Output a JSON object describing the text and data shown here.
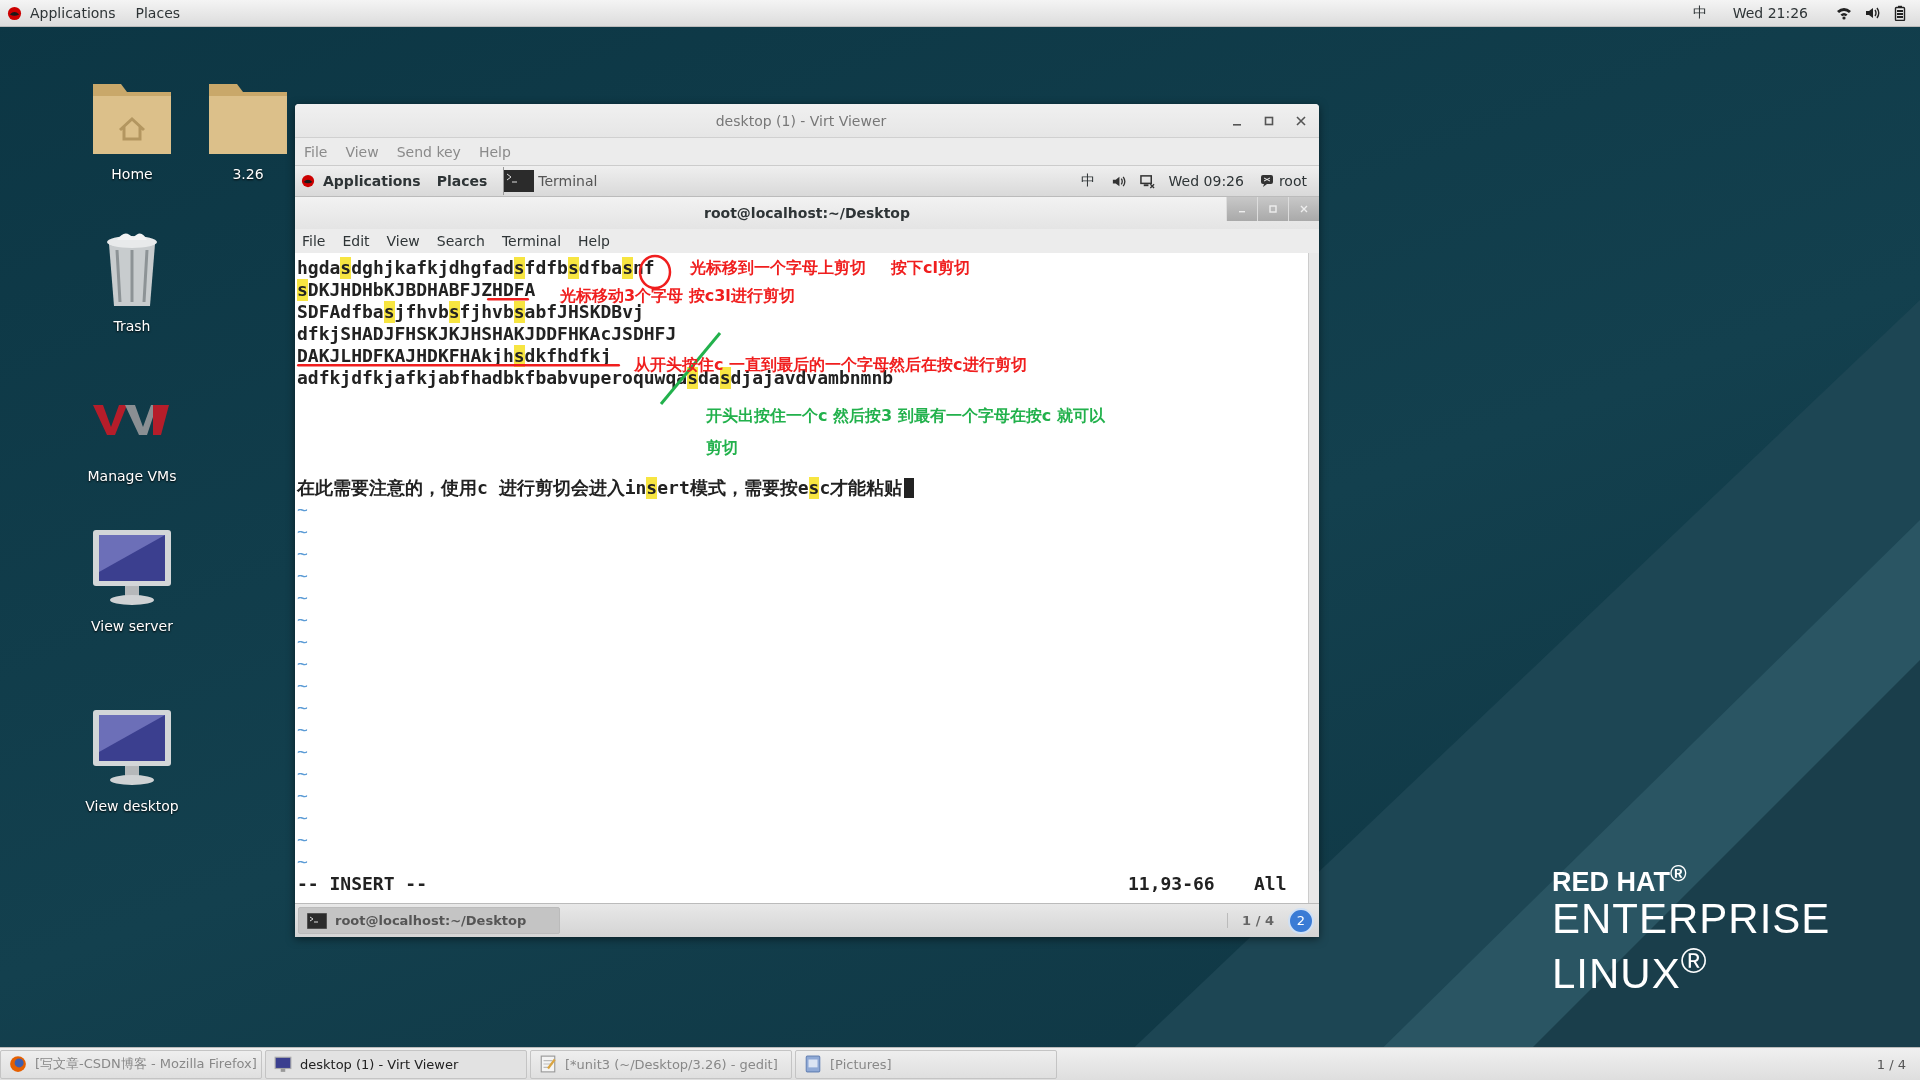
{
  "top_bar": {
    "menus": [
      "Applications",
      "Places"
    ],
    "input_method": "中",
    "clock": "Wed 21:26"
  },
  "desktop_icons": [
    {
      "label": "Home",
      "kind": "home"
    },
    {
      "label": "3.26",
      "kind": "folder"
    },
    {
      "label": "Trash",
      "kind": "trash"
    },
    {
      "label": "Manage VMs",
      "kind": "vm"
    },
    {
      "label": "View server",
      "kind": "monitor"
    },
    {
      "label": "View desktop",
      "kind": "monitor"
    }
  ],
  "viewer": {
    "title": "desktop (1) - Virt Viewer",
    "menus": [
      "File",
      "View",
      "Send key",
      "Help"
    ],
    "guest_panel": {
      "menus": [
        "Applications",
        "Places"
      ],
      "window_button": "Terminal",
      "input_method": "中",
      "clock": "Wed 09:26",
      "user": "root"
    },
    "terminal": {
      "title": "root@localhost:~/Desktop",
      "menus": [
        "File",
        "Edit",
        "View",
        "Search",
        "Terminal",
        "Help"
      ],
      "lines": [
        {
          "kind": "text",
          "segments": [
            {
              "text": "hgda",
              "highlight": false
            },
            {
              "text": "s",
              "highlight": true
            },
            {
              "text": "dghjkafkjdhgfad",
              "highlight": false
            },
            {
              "text": "s",
              "highlight": true
            },
            {
              "text": "fdfb",
              "highlight": false
            },
            {
              "text": "s",
              "highlight": true
            },
            {
              "text": "dfba",
              "highlight": false
            },
            {
              "text": "s",
              "highlight": true
            },
            {
              "text": "nf",
              "highlight": false
            }
          ]
        },
        {
          "kind": "text",
          "segments": [
            {
              "text": "s",
              "highlight": true
            },
            {
              "text": "DKJHDHbKJBDHABFJZHDFA",
              "highlight": false
            }
          ]
        },
        {
          "kind": "text",
          "segments": [
            {
              "text": "SDFAdfba",
              "highlight": false
            },
            {
              "text": "s",
              "highlight": true
            },
            {
              "text": "jfhvb",
              "highlight": false
            },
            {
              "text": "s",
              "highlight": true
            },
            {
              "text": "fjhvb",
              "highlight": false
            },
            {
              "text": "s",
              "highlight": true
            },
            {
              "text": "abfJHSKDBvj",
              "highlight": false
            }
          ]
        },
        {
          "kind": "text",
          "segments": [
            {
              "text": "dfkjSHADJFHSKJKJHSHAKJDDFHKAcJSDHFJ",
              "highlight": false
            }
          ]
        },
        {
          "kind": "text",
          "segments": [
            {
              "text": "DAKJLHDFKAJHDKFHAkjh",
              "highlight": false
            },
            {
              "text": "s",
              "highlight": true
            },
            {
              "text": "dkfhdfkj",
              "highlight": false
            }
          ]
        },
        {
          "kind": "text",
          "segments": [
            {
              "text": "adfkjdfkjafkjabfhadbkfbabvuperoquwqa",
              "highlight": false
            },
            {
              "text": "s",
              "highlight": true
            },
            {
              "text": "da",
              "highlight": false
            },
            {
              "text": "s",
              "highlight": true
            },
            {
              "text": "djajavdvambnmnb",
              "highlight": false
            }
          ]
        },
        {
          "kind": "blank"
        },
        {
          "kind": "blank"
        },
        {
          "kind": "blank"
        },
        {
          "kind": "blank"
        },
        {
          "kind": "text",
          "cursor": true,
          "segments": [
            {
              "text": "在此需要注意的，使用c 进行剪切会进入in",
              "highlight": false
            },
            {
              "text": "s",
              "highlight": true
            },
            {
              "text": "ert模式，需要按e",
              "highlight": false
            },
            {
              "text": "s",
              "highlight": true
            },
            {
              "text": "c才能粘贴",
              "highlight": false
            }
          ]
        }
      ],
      "tildes": [
        "~",
        "~",
        "~",
        "~",
        "~",
        "~",
        "~",
        "~",
        "~",
        "~",
        "~",
        "~",
        "~",
        "~",
        "~",
        "~",
        "~"
      ],
      "mode": "-- INSERT --",
      "position": "11,93-66",
      "scroll": "All",
      "annotations": [
        {
          "text": "光标移到一个字母上剪切",
          "color": "#f01e1e"
        },
        {
          "text": "按下cl剪切",
          "color": "#f01e1e"
        },
        {
          "text": "光标移动3个字母 按c3l进行剪切",
          "color": "#f01e1e"
        },
        {
          "text": "从开头按住c 一直到最后的一个字母然后在按c进行剪切",
          "color": "#f01e1e"
        },
        {
          "text": "开头出按住一个c 然后按3 到最有一个字母在按c 就可以剪切",
          "color": "#22b14c"
        }
      ]
    },
    "guest_taskbar": {
      "items": [
        {
          "label": "root@localhost:~/Desktop",
          "selected": true
        }
      ],
      "workspace": "1 / 4",
      "badge": "2"
    }
  },
  "taskbar": {
    "items": [
      {
        "label": "[写文章-CSDN博客 - Mozilla Firefox]",
        "kind": "browser",
        "selected": false
      },
      {
        "label": "desktop (1) - Virt Viewer",
        "kind": "viewer",
        "selected": true
      },
      {
        "label": "[*unit3 (~/Desktop/3.26) - gedit]",
        "kind": "editor",
        "selected": false
      },
      {
        "label": "[Pictures]",
        "kind": "files",
        "selected": false
      }
    ],
    "workspace": "1 / 4"
  },
  "branding": [
    "RED HAT$^{®}$",
    "ENTERPRISE",
    "LINUX$^{®}$"
  ]
}
